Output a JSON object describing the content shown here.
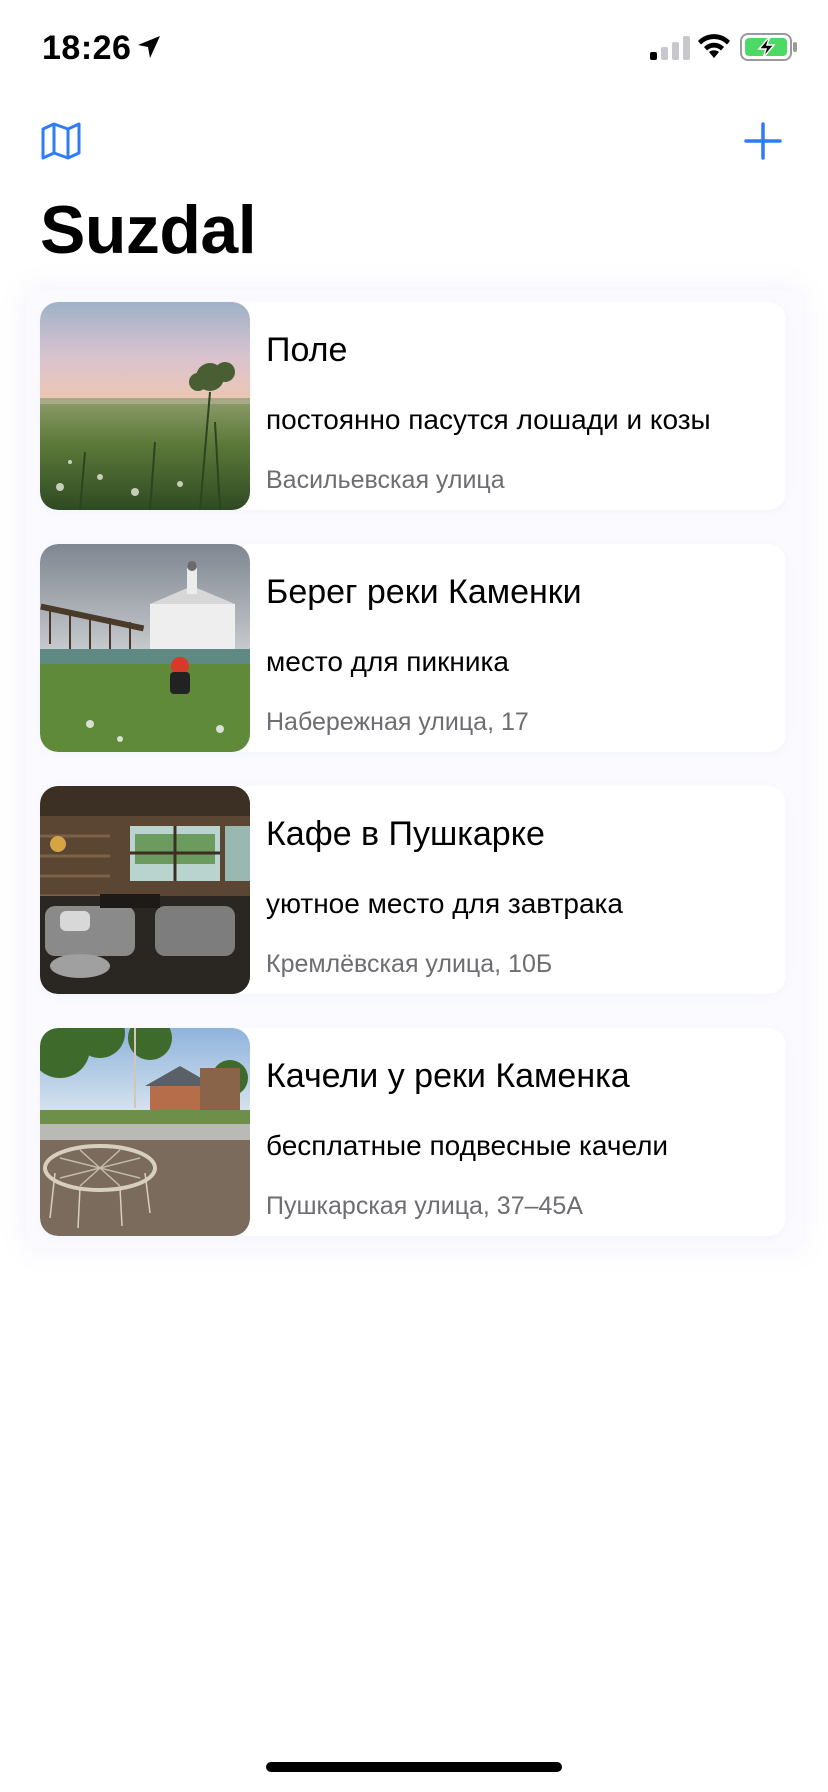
{
  "status_bar": {
    "time": "18:26",
    "icons": [
      "location-arrow-icon",
      "signal-icon",
      "wifi-icon",
      "battery-charging-icon"
    ],
    "battery_color": "#4cd964"
  },
  "nav": {
    "left_icon": "map-icon",
    "right_icon": "plus-icon",
    "accent_color": "#2f7cf6"
  },
  "page": {
    "title": "Suzdal"
  },
  "places": [
    {
      "title": "Поле",
      "description": "постоянно пасутся лошади и козы",
      "address": "Васильевская улица",
      "image": "field-photo"
    },
    {
      "title": "Берег реки Каменки",
      "description": "место для пикника",
      "address": "Набережная улица, 17",
      "image": "riverbank-church-photo"
    },
    {
      "title": "Кафе в Пушкарке",
      "description": "уютное место для завтрака",
      "address": "Кремлёвская улица, 10Б",
      "image": "cafe-interior-photo"
    },
    {
      "title": "Качели у реки Каменка",
      "description": "бесплатные подвесные качели",
      "address": "Пушкарская улица, 37–45А",
      "image": "hanging-swing-photo"
    }
  ]
}
